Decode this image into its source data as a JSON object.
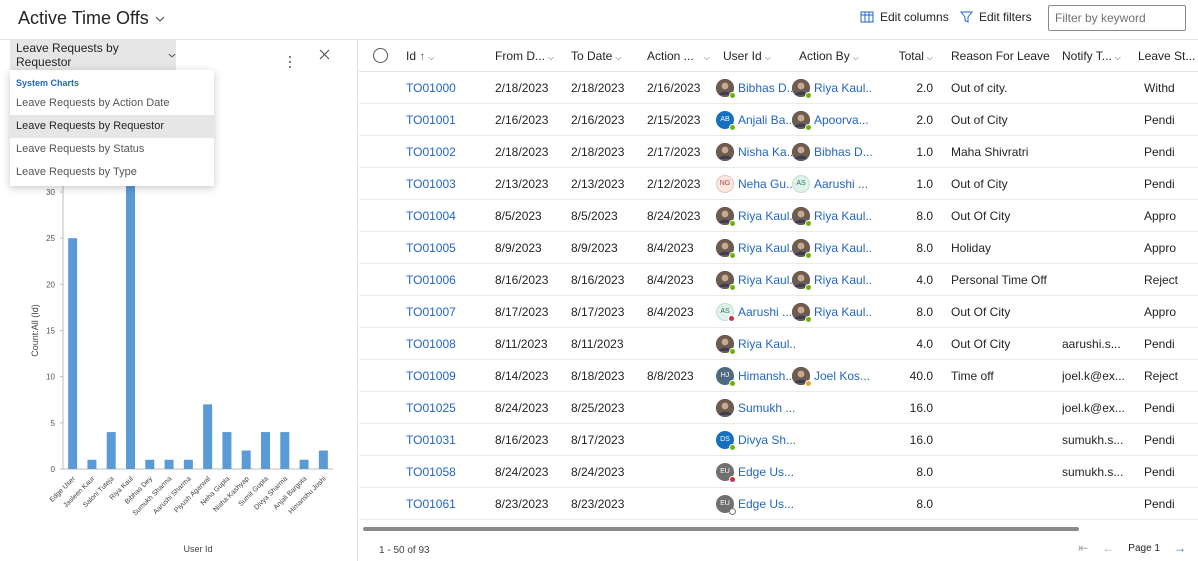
{
  "header": {
    "title": "Active Time Offs",
    "edit_columns": "Edit columns",
    "edit_filters": "Edit filters",
    "filter_placeholder": "Filter by keyword"
  },
  "chart_panel": {
    "selected_chart": "Leave Requests by Requestor",
    "dropdown": {
      "group_label": "System Charts",
      "options": [
        "Leave Requests by Action Date",
        "Leave Requests by Requestor",
        "Leave Requests by Status",
        "Leave Requests by Type"
      ],
      "selected_index": 1
    }
  },
  "chart_data": {
    "type": "bar",
    "xlabel": "User Id",
    "ylabel": "Count:All (Id)",
    "ylim": [
      0,
      30
    ],
    "yticks": [
      0,
      5,
      10,
      15,
      20,
      25,
      30
    ],
    "categories": [
      "Edge User",
      "Jasleen Kaur",
      "Saloni Tuteja",
      "Riya Kaul",
      "Bibhas Dey",
      "Sumukh Sharma",
      "Aarushi Sharma",
      "Piyush Agarwal",
      "Neha Gupta",
      "Nisha Kashyap",
      "Sumit Gupta",
      "Divya Sharma",
      "Anjali Bargota",
      "Himanshu Joshi"
    ],
    "values": [
      25,
      1,
      4,
      31,
      1,
      1,
      1,
      7,
      4,
      2,
      4,
      4,
      1,
      2
    ]
  },
  "grid": {
    "columns": [
      "Id",
      "From D...",
      "To Date",
      "Action ...",
      "User Id",
      "Action By",
      "Total",
      "Reason For Leave",
      "Notify T...",
      "Leave St..."
    ],
    "sort_indicator": "↑",
    "rows": [
      {
        "id": "TO01000",
        "from": "2/18/2023",
        "to": "2/18/2023",
        "action": "2/16/2023",
        "user": "Bibhas D...",
        "user_av": "photo",
        "user_st": "#6bb700",
        "by": "Riya Kaul...",
        "by_av": "photo",
        "by_st": "#6bb700",
        "total": "2.0",
        "reason": "Out of city.",
        "notify": "",
        "status": "Withd"
      },
      {
        "id": "TO01001",
        "from": "2/16/2023",
        "to": "2/16/2023",
        "action": "2/15/2023",
        "user": "Anjali Ba...",
        "user_av": "ab",
        "user_init": "AB",
        "user_st": "#6bb700",
        "by": "Apoorva...",
        "by_av": "photo",
        "by_st": "#6bb700",
        "total": "2.0",
        "reason": "Out of City",
        "notify": "",
        "status": "Pendi"
      },
      {
        "id": "TO01002",
        "from": "2/18/2023",
        "to": "2/18/2023",
        "action": "2/17/2023",
        "user": "Nisha Ka...",
        "user_av": "photo",
        "user_st": "",
        "by": "Bibhas D...",
        "by_av": "photo",
        "by_st": "",
        "total": "1.0",
        "reason": "Maha Shivratri",
        "notify": "",
        "status": "Pendi"
      },
      {
        "id": "TO01003",
        "from": "2/13/2023",
        "to": "2/13/2023",
        "action": "2/12/2023",
        "user": "Neha Gu...",
        "user_av": "ng",
        "user_init": "NG",
        "user_st": "",
        "by": "Aarushi ...",
        "by_av": "as",
        "by_init": "AS",
        "by_st": "",
        "total": "1.0",
        "reason": "Out of City",
        "notify": "",
        "status": "Pendi"
      },
      {
        "id": "TO01004",
        "from": "8/5/2023",
        "to": "8/5/2023",
        "action": "8/24/2023",
        "user": "Riya Kaul...",
        "user_av": "photo",
        "user_st": "#6bb700",
        "by": "Riya Kaul...",
        "by_av": "photo",
        "by_st": "#6bb700",
        "total": "8.0",
        "reason": "Out Of City",
        "notify": "",
        "status": "Appro"
      },
      {
        "id": "TO01005",
        "from": "8/9/2023",
        "to": "8/9/2023",
        "action": "8/4/2023",
        "user": "Riya Kaul...",
        "user_av": "photo",
        "user_st": "#6bb700",
        "by": "Riya Kaul...",
        "by_av": "photo",
        "by_st": "#6bb700",
        "total": "8.0",
        "reason": "Holiday",
        "notify": "",
        "status": "Appro"
      },
      {
        "id": "TO01006",
        "from": "8/16/2023",
        "to": "8/16/2023",
        "action": "8/4/2023",
        "user": "Riya Kaul...",
        "user_av": "photo",
        "user_st": "#6bb700",
        "by": "Riya Kaul...",
        "by_av": "photo",
        "by_st": "#6bb700",
        "total": "4.0",
        "reason": "Personal Time Off",
        "notify": "",
        "status": "Reject"
      },
      {
        "id": "TO01007",
        "from": "8/17/2023",
        "to": "8/17/2023",
        "action": "8/4/2023",
        "user": "Aarushi ...",
        "user_av": "as",
        "user_init": "AS",
        "user_st": "#c4314b",
        "by": "Riya Kaul...",
        "by_av": "photo",
        "by_st": "#6bb700",
        "total": "8.0",
        "reason": "Out Of City",
        "notify": "",
        "status": "Appro"
      },
      {
        "id": "TO01008",
        "from": "8/11/2023",
        "to": "8/11/2023",
        "action": "",
        "user": "Riya Kaul...",
        "user_av": "photo",
        "user_st": "#6bb700",
        "by": "",
        "by_av": "",
        "by_st": "",
        "total": "4.0",
        "reason": "Out Of City",
        "notify": "aarushi.s...",
        "status": "Pendi"
      },
      {
        "id": "TO01009",
        "from": "8/14/2023",
        "to": "8/18/2023",
        "action": "8/8/2023",
        "user": "Himansh...",
        "user_av": "hj",
        "user_init": "HJ",
        "user_st": "#6bb700",
        "by": "Joel Kos...",
        "by_av": "photo",
        "by_st": "#e8a33d",
        "total": "40.0",
        "reason": "Time off",
        "notify": "joel.k@ex...",
        "status": "Reject"
      },
      {
        "id": "TO01025",
        "from": "8/24/2023",
        "to": "8/25/2023",
        "action": "",
        "user": "Sumukh ...",
        "user_av": "photo",
        "user_st": "",
        "by": "",
        "by_av": "",
        "by_st": "",
        "total": "16.0",
        "reason": "",
        "notify": "joel.k@ex...",
        "status": "Pendi"
      },
      {
        "id": "TO01031",
        "from": "8/16/2023",
        "to": "8/17/2023",
        "action": "",
        "user": "Divya Sh...",
        "user_av": "ds",
        "user_init": "DS",
        "user_st": "#6bb700",
        "by": "",
        "by_av": "",
        "by_st": "",
        "total": "16.0",
        "reason": "",
        "notify": "sumukh.s...",
        "status": "Pendi"
      },
      {
        "id": "TO01058",
        "from": "8/24/2023",
        "to": "8/24/2023",
        "action": "",
        "user": "Edge Us...",
        "user_av": "eu",
        "user_init": "EU",
        "user_st": "#c4314b",
        "by": "",
        "by_av": "",
        "by_st": "",
        "total": "8.0",
        "reason": "",
        "notify": "sumukh.s...",
        "status": "Pendi"
      },
      {
        "id": "TO01061",
        "from": "8/23/2023",
        "to": "8/23/2023",
        "action": "",
        "user": "Edge Us...",
        "user_av": "eu",
        "user_init": "EU",
        "user_st": "#ffffff",
        "by": "",
        "by_av": "",
        "by_st": "",
        "total": "8.0",
        "reason": "",
        "notify": "",
        "status": "Pendi"
      }
    ]
  },
  "footer": {
    "record_count": "1 - 50 of 93",
    "page_label": "Page 1"
  },
  "colors": {
    "accent": "#2266c4",
    "bar": "#5b9bd5",
    "online": "#6bb700",
    "busy": "#c4314b",
    "away": "#e8a33d"
  }
}
